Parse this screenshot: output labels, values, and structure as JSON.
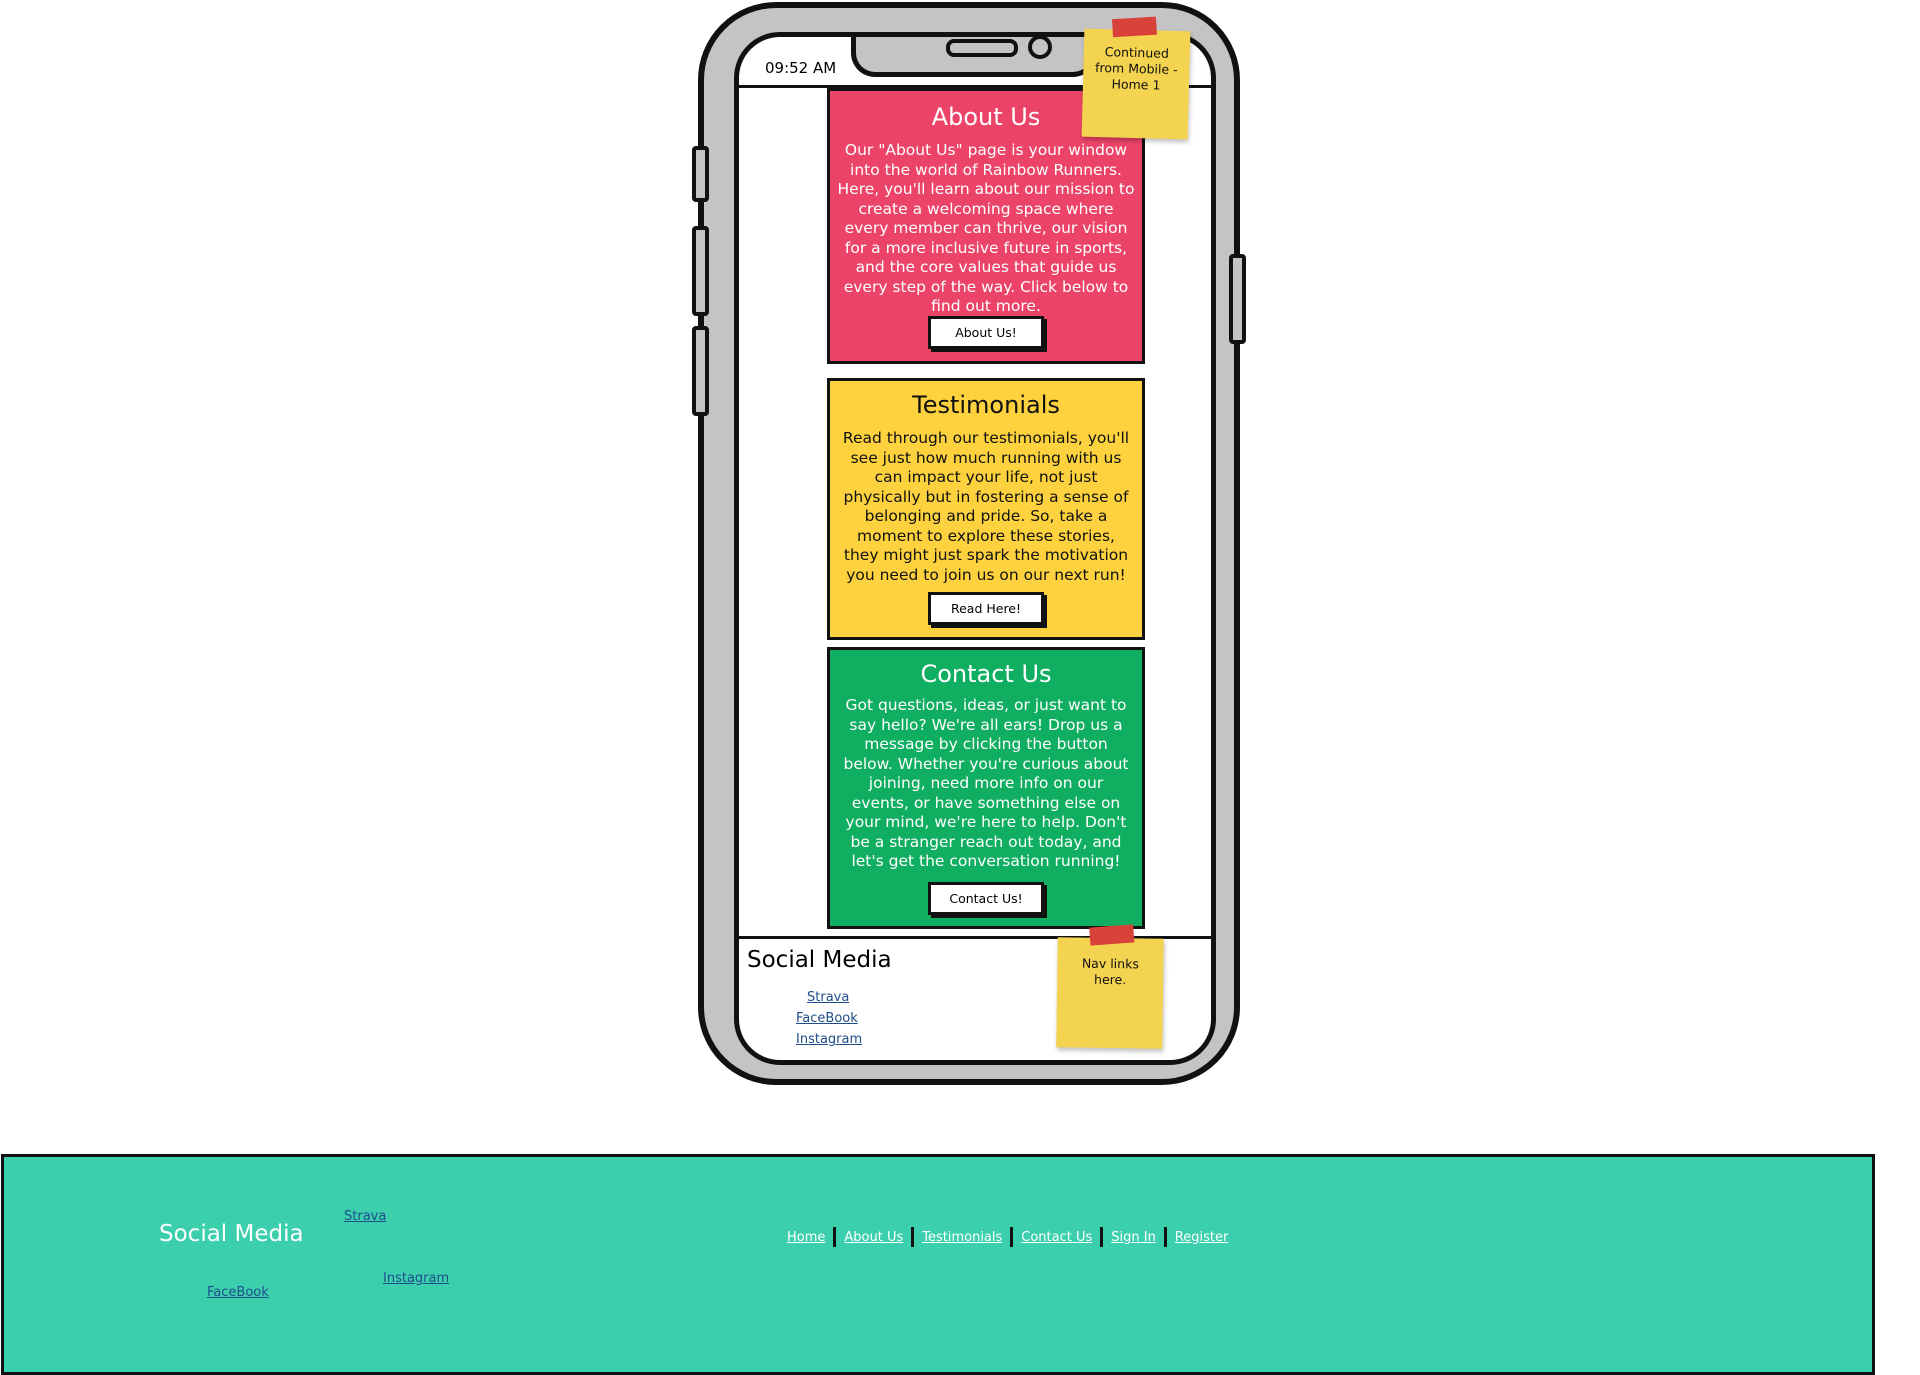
{
  "status_bar": {
    "time": "09:52 AM"
  },
  "sticky_notes": {
    "top": "Continued from Mobile - Home 1",
    "bottom": "Nav links here."
  },
  "cards": {
    "about": {
      "title": "About Us",
      "body": "Our \"About Us\" page is your window into the world of Rainbow Runners. Here, you'll learn about our mission to create a welcoming space where every member can thrive, our vision for a more inclusive future in sports, and the core values that guide us every step of the way. Click below to find out more.",
      "button": "About Us!"
    },
    "testimonials": {
      "title": "Testimonials",
      "body": "Read through our testimonials, you'll see just how much running with us can impact your life, not just physically but in fostering a sense of belonging and pride. So, take a moment to explore these stories, they might just spark the motivation you need to join us on our next run!",
      "button": "Read Here!"
    },
    "contact": {
      "title": "Contact Us",
      "body": "Got questions, ideas, or just want to say hello? We're all ears! Drop us a message by clicking the button below. Whether you're curious about joining, need more info on our events, or have something else on your mind, we're here to help. Don't be a stranger reach out today, and let's get the conversation running!",
      "button": "Contact Us!"
    }
  },
  "mobile_footer": {
    "title": "Social Media",
    "links": [
      "Strava",
      "FaceBook",
      "Instagram"
    ]
  },
  "desktop_footer": {
    "title": "Social Media",
    "social_links": {
      "strava": "Strava",
      "instagram": "Instagram",
      "facebook": "FaceBook"
    },
    "nav": [
      "Home",
      "About Us",
      "Testimonials",
      "Contact Us",
      "Sign In",
      "Register"
    ]
  },
  "colors": {
    "about_bg": "#ec4469",
    "testimonials_bg": "#fdd23e",
    "contact_bg": "#0fae61",
    "footer_bg": "#3bcfad",
    "sticky_bg": "#f4d350",
    "tape": "#d94238"
  }
}
